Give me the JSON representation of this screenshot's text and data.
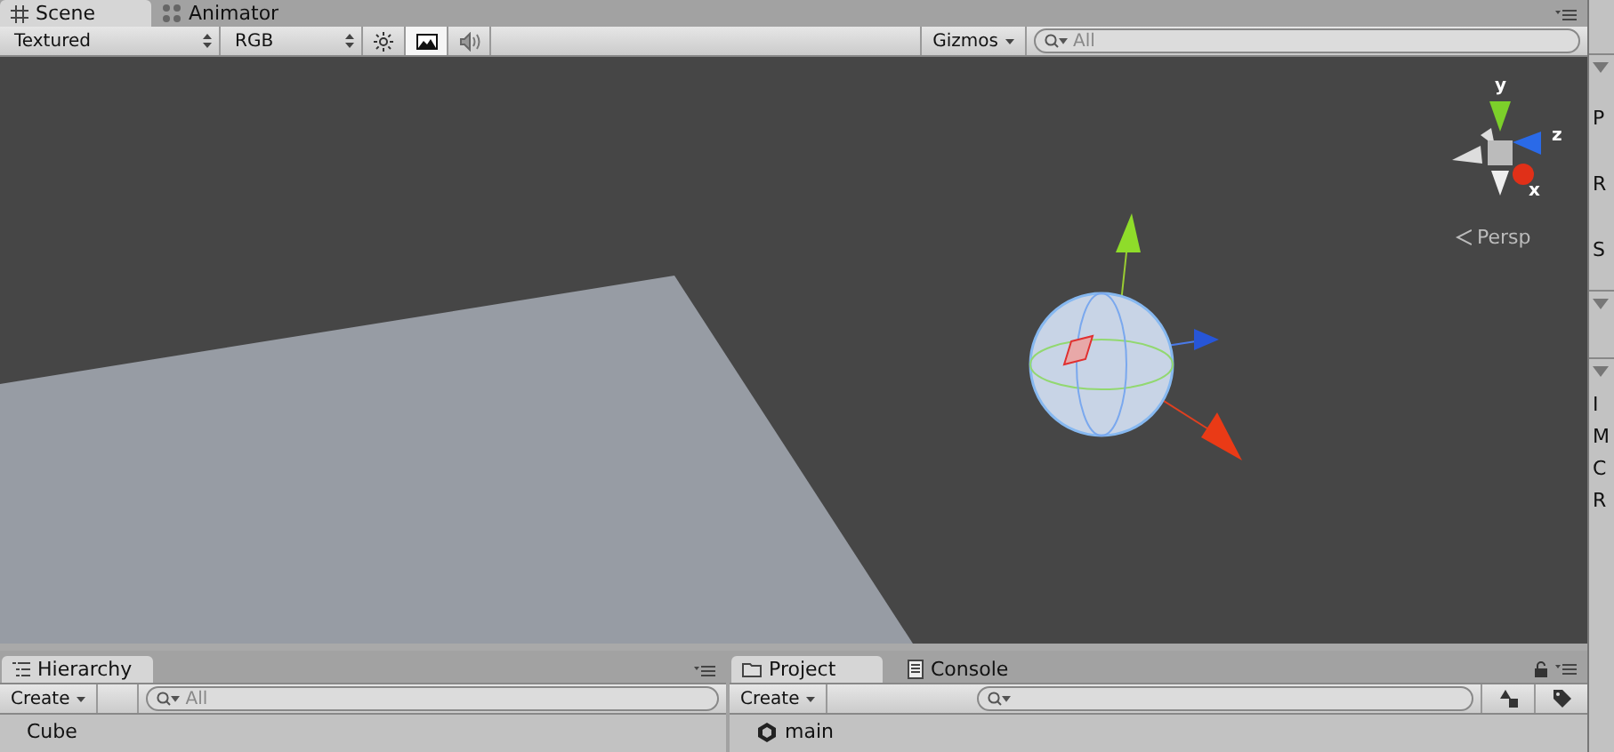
{
  "scene_view": {
    "tabs": [
      {
        "label": "Scene",
        "selected": true,
        "kind": "grid"
      },
      {
        "label": "Animator",
        "selected": false,
        "kind": "nodes"
      }
    ],
    "toolbar": {
      "draw_mode": "Textured",
      "render_mode": "RGB",
      "toggles": [
        {
          "kind": "lighting",
          "on": false
        },
        {
          "kind": "image",
          "on": true
        },
        {
          "kind": "audio",
          "on": false
        }
      ],
      "gizmos": "Gizmos",
      "search": {
        "placeholder": "All"
      }
    },
    "viewport": {
      "axis_labels": [
        "y",
        "z",
        "x"
      ],
      "projection": "Persp"
    }
  },
  "hierarchy": {
    "tabs": [
      {
        "label": "Hierarchy",
        "selected": true,
        "kind": "list"
      }
    ],
    "create": "Create",
    "search": {
      "placeholder": "All"
    },
    "items": [
      "Cube"
    ]
  },
  "project": {
    "tabs": [
      {
        "label": "Project",
        "selected": true,
        "kind": "folder"
      },
      {
        "label": "Console",
        "selected": false,
        "kind": "doc"
      }
    ],
    "create": "Create",
    "items": [
      "main"
    ]
  },
  "inspector": {
    "sections": [
      {
        "expanded": true,
        "labels": [
          "P",
          "R",
          "S"
        ]
      },
      {
        "expanded": true
      },
      {
        "expanded": true,
        "labels": [
          "I",
          "M",
          "C",
          "R"
        ]
      }
    ]
  }
}
